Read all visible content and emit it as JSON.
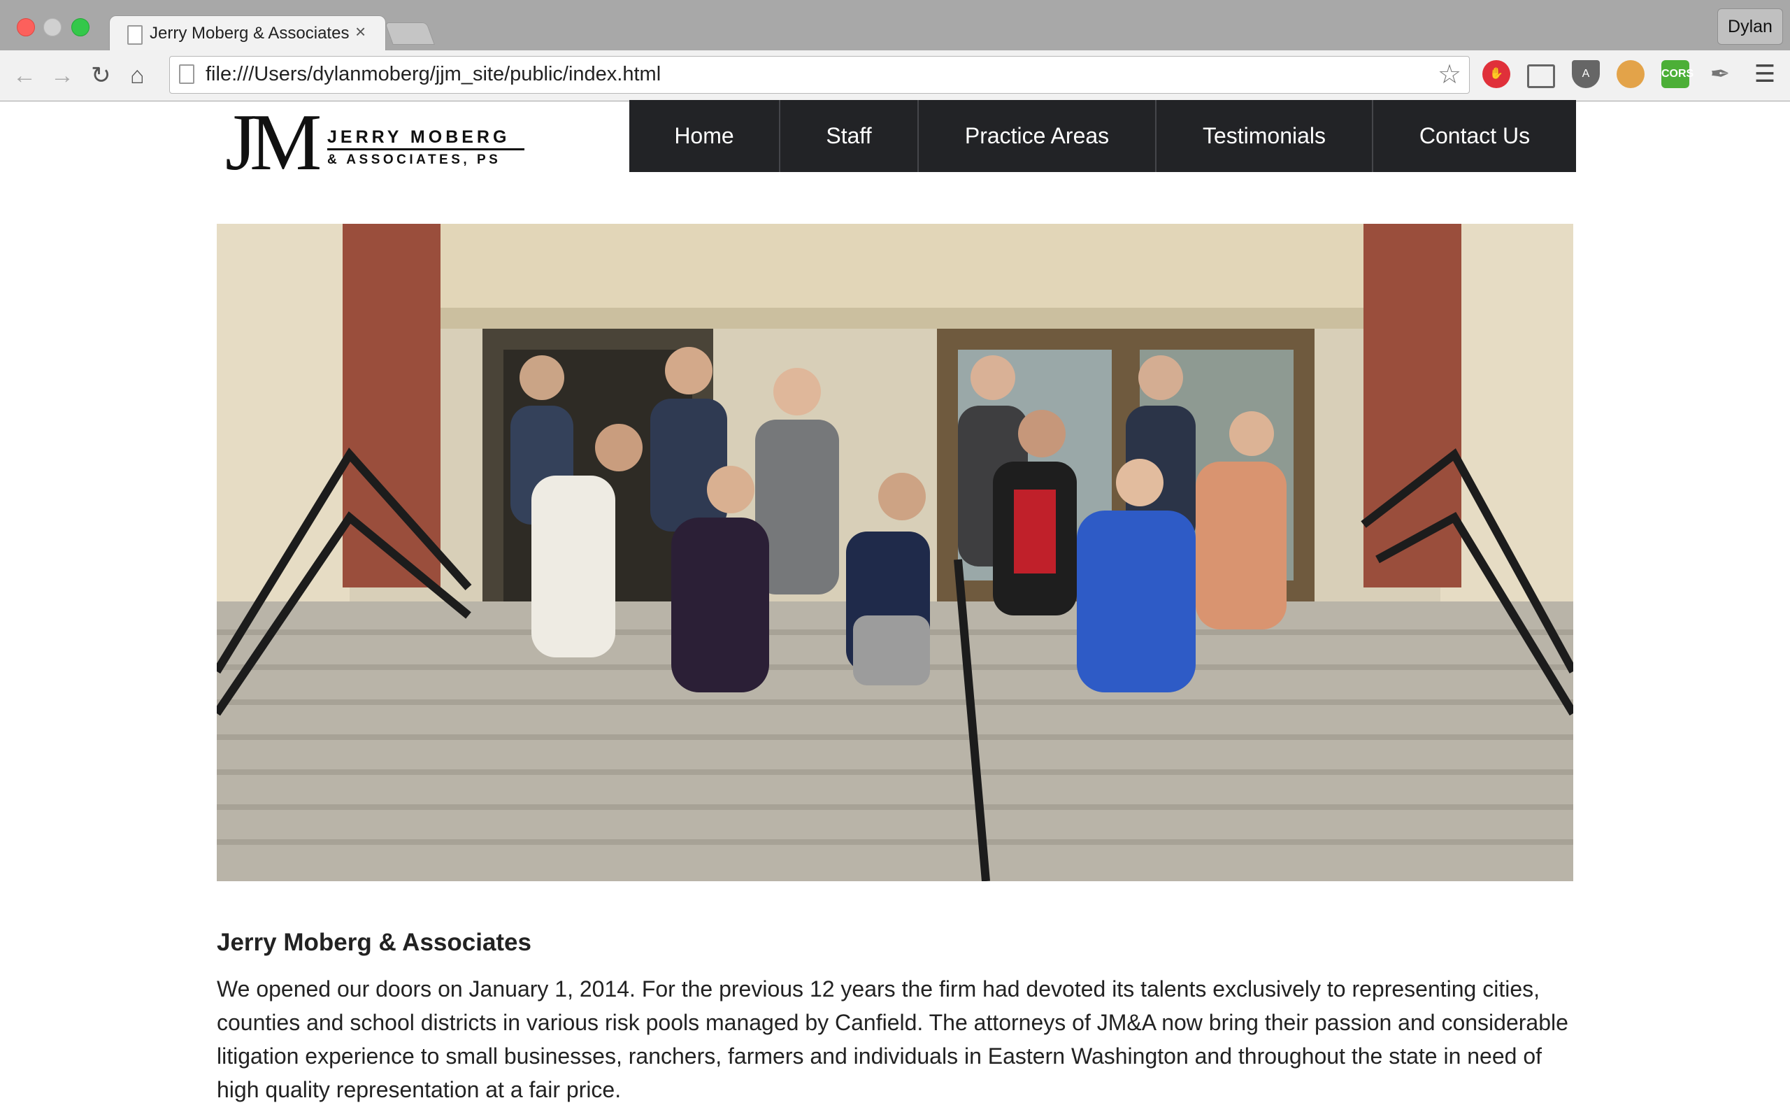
{
  "browser": {
    "tab_title": "Jerry Moberg & Associates",
    "tab_close": "×",
    "profile": "Dylan",
    "url": "file:///Users/dylanmoberg/jjm_site/public/index.html",
    "extensions": [
      "stop-icon",
      "cast-icon",
      "shield-icon",
      "cookie-icon",
      "cors-icon",
      "eyedropper-icon",
      "menu-icon"
    ],
    "cors_label": "CORS"
  },
  "logo": {
    "initials": "JM",
    "line1": "JERRY MOBERG",
    "line2": "& ASSOCIATES, PS"
  },
  "nav": {
    "items": [
      "Home",
      "Staff",
      "Practice Areas",
      "Testimonials",
      "Contact Us"
    ]
  },
  "hero": {
    "image": "team-photo-on-courthouse-steps"
  },
  "content": {
    "title": "Jerry Moberg & Associates",
    "body": "We opened our doors on January 1, 2014. For the previous 12 years the firm had devoted its talents exclusively to representing cities, counties and school districts in various risk pools managed by Canfield. The attorneys of JM&A now bring their passion and considerable litigation experience to small businesses, ranchers, farmers and individuals in Eastern Washington and throughout the state in need of high quality representation at a fair price."
  },
  "colors": {
    "nav_bg": "#222326",
    "nav_text": "#ffffff",
    "text": "#222222"
  }
}
